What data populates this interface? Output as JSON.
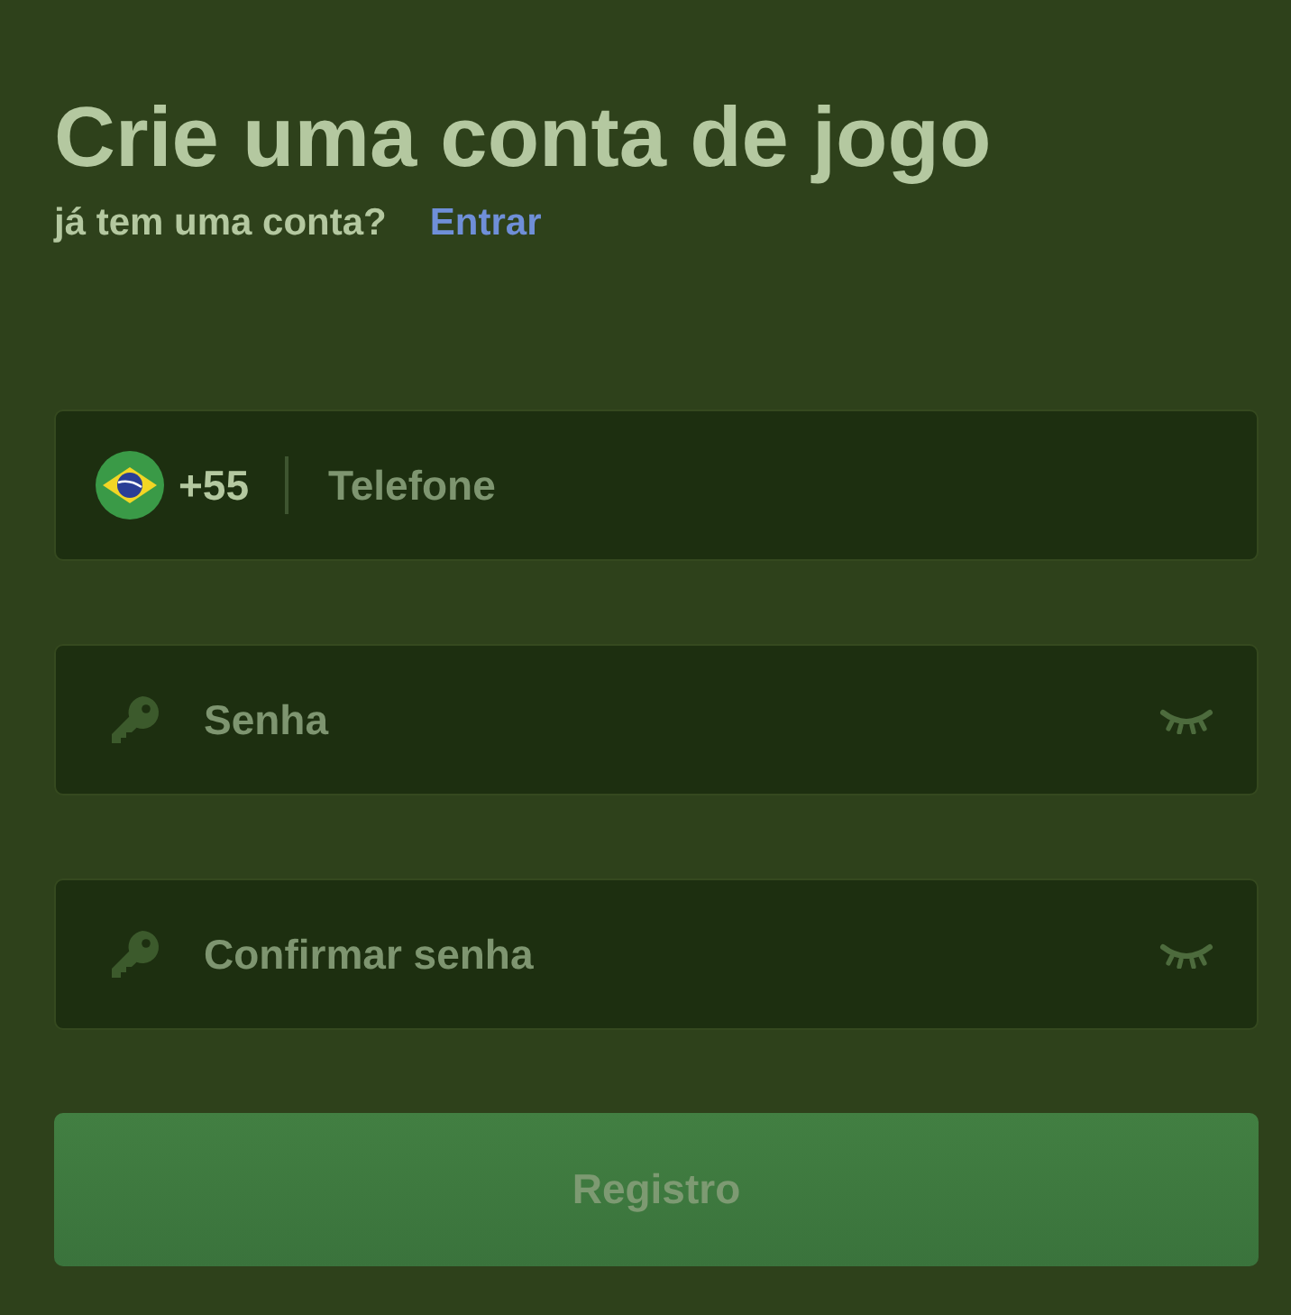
{
  "title": "Crie uma conta de jogo",
  "login_prompt": {
    "text": "já tem uma conta?",
    "link": "Entrar"
  },
  "phone_field": {
    "country_code": "+55",
    "placeholder": "Telefone"
  },
  "password_fields": [
    {
      "placeholder": "Senha"
    },
    {
      "placeholder": "Confirmar senha"
    }
  ],
  "submit_button": "Registro"
}
